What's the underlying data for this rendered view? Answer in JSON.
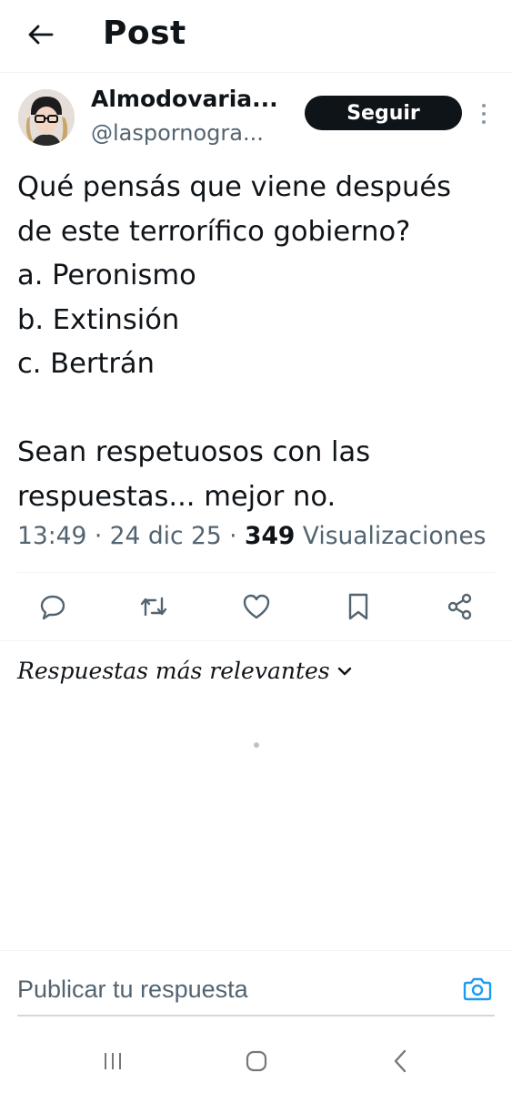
{
  "header": {
    "title": "Post",
    "back_icon": "arrow-left-icon"
  },
  "author": {
    "display_name": "Almodovaria...",
    "handle": "@laspornogra...",
    "follow_label": "Seguir",
    "avatar_icon": "avatar"
  },
  "post": {
    "lines": [
      "Qué pensás que viene después",
      "de este terrorífico gobierno?",
      "a. Peronismo",
      "b. Extinsión",
      "c. Bertrán",
      "",
      "Sean respetuosos con las",
      "respuestas... mejor no."
    ],
    "time": "13:49",
    "date": "24 dic 25",
    "views_count": "349",
    "views_label": "Visualizaciones"
  },
  "actions": [
    {
      "name": "reply",
      "icon": "reply-icon"
    },
    {
      "name": "repost",
      "icon": "repost-icon"
    },
    {
      "name": "like",
      "icon": "heart-icon"
    },
    {
      "name": "bookmark",
      "icon": "bookmark-icon"
    },
    {
      "name": "share",
      "icon": "share-icon"
    }
  ],
  "replies": {
    "sort_label": "Respuestas más relevantes"
  },
  "composer": {
    "placeholder": "Publicar tu respuesta",
    "camera_icon": "camera-icon"
  },
  "system_nav": {
    "recents_icon": "recents-icon",
    "home_icon": "home-icon",
    "back_icon": "back-icon"
  },
  "colors": {
    "text": "#0f1419",
    "secondary": "#536471",
    "accent": "#1d9bf0",
    "button_bg": "#0f1419"
  }
}
